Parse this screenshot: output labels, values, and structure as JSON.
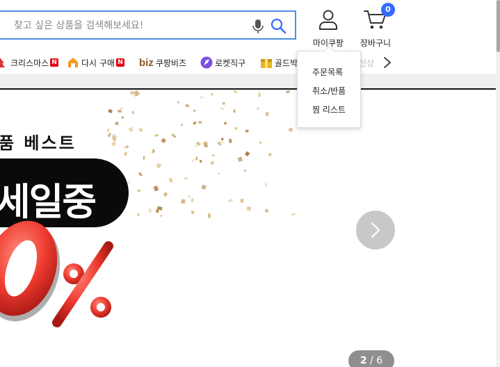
{
  "search": {
    "placeholder": "찾고 싶은 상품을 검색해보세요!"
  },
  "header": {
    "mypage_label": "마이쿠팡",
    "cart_label": "장바구니",
    "cart_count": "0"
  },
  "categories": [
    {
      "label": "크리스마스",
      "badge": "N",
      "icon": "christmas-icon"
    },
    {
      "label": "다시 구매",
      "badge": "N",
      "icon": "rebuy-icon"
    },
    {
      "label": "쿠팡비즈",
      "logo": "biz",
      "icon": "biz-icon"
    },
    {
      "label": "로켓직구",
      "icon": "rocket-direct-icon"
    },
    {
      "label": "골드박스",
      "icon": "goldbox-icon"
    },
    {
      "label": "신상",
      "icon": "new-icon"
    }
  ],
  "dropdown": {
    "items": [
      "주문목록",
      "취소/반품",
      "찜 리스트"
    ]
  },
  "banner": {
    "subtitle": "품 베스트",
    "sale_text": "세일중",
    "page_current": "2",
    "page_separator": " / ",
    "page_total": "6"
  },
  "colors": {
    "accent": "#346aff",
    "search_border": "#4a90e2",
    "sale_red": "#e8312f"
  }
}
